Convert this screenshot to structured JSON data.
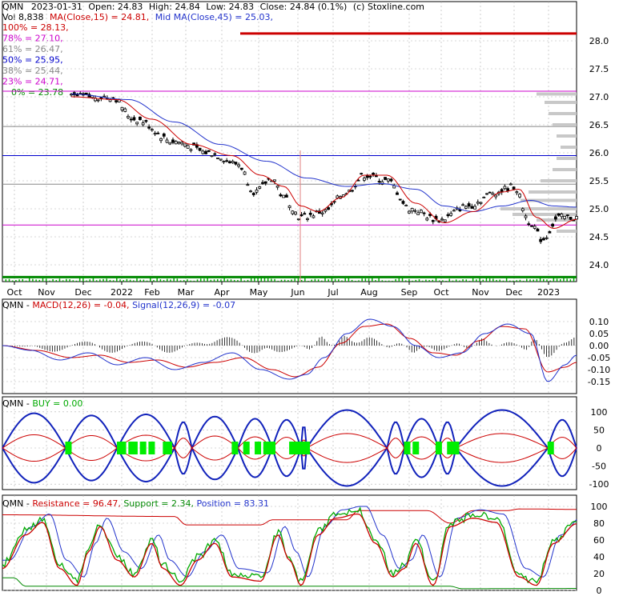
{
  "header": {
    "line1": {
      "ticker": "QMN",
      "date": "2023-01-31",
      "open": "Open: 24.83",
      "high": "High: 24.84",
      "low": "Low: 24.83",
      "close": "Close: 24.84 (0.1%)",
      "source": "(c) Stoxline.com"
    },
    "line2": {
      "vol": "Vol 8,838",
      "ma15": "MA(Close,15) = 24.81,",
      "ma45": "Mid MA(Close,45) = 25.03,"
    },
    "fib": [
      {
        "label": "100% = 28.13,",
        "color": "#cc0000"
      },
      {
        "label": "78% = 27.10,",
        "color": "#cc00cc"
      },
      {
        "label": "61% = 26.47,",
        "color": "#888888"
      },
      {
        "label": "50% = 25.95,",
        "color": "#0000cc"
      },
      {
        "label": "38% = 25.44,",
        "color": "#888888"
      },
      {
        "label": "23% = 24.71,",
        "color": "#cc00cc"
      },
      {
        "label": "0% = 23.78",
        "color": "#008800"
      }
    ]
  },
  "chart_data": [
    {
      "type": "candlestick",
      "panel": "price",
      "ylim": [
        23.7,
        28.3
      ],
      "yticks": [
        "28.0",
        "27.5",
        "27.0",
        "26.5",
        "26.0",
        "25.5",
        "25.0",
        "24.5",
        "24.0"
      ],
      "ytick_values": [
        28.0,
        27.5,
        27.0,
        26.5,
        26.0,
        25.5,
        25.0,
        24.5,
        24.0
      ],
      "xticks": [
        "Oct",
        "Nov",
        "Dec",
        "2022",
        "Feb",
        "Mar",
        "Apr",
        "May",
        "Jun",
        "Jul",
        "Aug",
        "Sep",
        "Oct",
        "Nov",
        "Dec",
        "2023"
      ],
      "fib_levels": [
        {
          "value": 28.13,
          "color": "#cc0000"
        },
        {
          "value": 27.1,
          "color": "#cc00cc"
        },
        {
          "value": 26.47,
          "color": "#888888"
        },
        {
          "value": 25.95,
          "color": "#0000cc"
        },
        {
          "value": 25.44,
          "color": "#888888"
        },
        {
          "value": 24.71,
          "color": "#cc00cc"
        },
        {
          "value": 23.78,
          "color": "#008800"
        }
      ],
      "close_keypoints": [
        [
          0.12,
          27.0
        ],
        [
          0.19,
          27.0
        ],
        [
          0.23,
          26.6
        ],
        [
          0.3,
          26.2
        ],
        [
          0.36,
          26.0
        ],
        [
          0.41,
          25.8
        ],
        [
          0.44,
          25.3
        ],
        [
          0.47,
          25.55
        ],
        [
          0.49,
          25.2
        ],
        [
          0.52,
          24.85
        ],
        [
          0.56,
          24.95
        ],
        [
          0.6,
          25.3
        ],
        [
          0.63,
          25.6
        ],
        [
          0.67,
          25.5
        ],
        [
          0.71,
          25.0
        ],
        [
          0.76,
          24.8
        ],
        [
          0.81,
          25.05
        ],
        [
          0.86,
          25.3
        ],
        [
          0.89,
          25.4
        ],
        [
          0.92,
          24.75
        ],
        [
          0.94,
          24.45
        ],
        [
          0.97,
          24.85
        ],
        [
          1.0,
          24.84
        ]
      ],
      "ma15_keypoints": [
        [
          0.12,
          27.0
        ],
        [
          0.2,
          26.95
        ],
        [
          0.26,
          26.6
        ],
        [
          0.33,
          26.15
        ],
        [
          0.4,
          25.95
        ],
        [
          0.45,
          25.6
        ],
        [
          0.49,
          25.4
        ],
        [
          0.52,
          25.05
        ],
        [
          0.55,
          24.95
        ],
        [
          0.59,
          25.2
        ],
        [
          0.63,
          25.6
        ],
        [
          0.67,
          25.6
        ],
        [
          0.72,
          25.1
        ],
        [
          0.77,
          24.75
        ],
        [
          0.82,
          24.95
        ],
        [
          0.87,
          25.3
        ],
        [
          0.9,
          25.35
        ],
        [
          0.93,
          24.85
        ],
        [
          0.96,
          24.65
        ],
        [
          1.0,
          24.81
        ]
      ],
      "ma45_keypoints": [
        [
          0.12,
          27.05
        ],
        [
          0.22,
          26.95
        ],
        [
          0.3,
          26.55
        ],
        [
          0.38,
          26.15
        ],
        [
          0.46,
          25.85
        ],
        [
          0.53,
          25.55
        ],
        [
          0.6,
          25.4
        ],
        [
          0.66,
          25.45
        ],
        [
          0.72,
          25.35
        ],
        [
          0.77,
          25.05
        ],
        [
          0.82,
          24.95
        ],
        [
          0.87,
          25.05
        ],
        [
          0.92,
          25.15
        ],
        [
          0.96,
          25.05
        ],
        [
          1.0,
          25.03
        ]
      ]
    },
    {
      "type": "line",
      "panel": "macd",
      "title_ticker": "QMN",
      "macd_label": "MACD(12,26) = -0.04,",
      "signal_label": "Signal(12,26,9) = -0.07",
      "ylim": [
        -0.2,
        0.15
      ],
      "yticks": [
        "0.10",
        "0.05",
        "0.00",
        "-0.05",
        "-0.10",
        "-0.15"
      ],
      "ytick_values": [
        0.1,
        0.05,
        0.0,
        -0.05,
        -0.1,
        -0.15
      ],
      "macd_keypoints": [
        [
          0,
          0.0
        ],
        [
          0.05,
          -0.02
        ],
        [
          0.1,
          -0.06
        ],
        [
          0.15,
          -0.03
        ],
        [
          0.2,
          -0.08
        ],
        [
          0.25,
          -0.05
        ],
        [
          0.3,
          -0.1
        ],
        [
          0.35,
          -0.07
        ],
        [
          0.4,
          -0.03
        ],
        [
          0.45,
          -0.1
        ],
        [
          0.5,
          -0.14
        ],
        [
          0.53,
          -0.12
        ],
        [
          0.56,
          -0.05
        ],
        [
          0.6,
          0.05
        ],
        [
          0.64,
          0.11
        ],
        [
          0.68,
          0.08
        ],
        [
          0.72,
          0.0
        ],
        [
          0.76,
          -0.05
        ],
        [
          0.8,
          -0.03
        ],
        [
          0.84,
          0.05
        ],
        [
          0.88,
          0.09
        ],
        [
          0.92,
          0.05
        ],
        [
          0.95,
          -0.15
        ],
        [
          0.98,
          -0.08
        ],
        [
          1.0,
          -0.04
        ]
      ],
      "signal_keypoints": [
        [
          0,
          0.0
        ],
        [
          0.06,
          -0.02
        ],
        [
          0.12,
          -0.05
        ],
        [
          0.17,
          -0.04
        ],
        [
          0.22,
          -0.07
        ],
        [
          0.27,
          -0.06
        ],
        [
          0.32,
          -0.09
        ],
        [
          0.37,
          -0.07
        ],
        [
          0.42,
          -0.05
        ],
        [
          0.47,
          -0.1
        ],
        [
          0.51,
          -0.13
        ],
        [
          0.55,
          -0.09
        ],
        [
          0.59,
          0.01
        ],
        [
          0.63,
          0.08
        ],
        [
          0.67,
          0.09
        ],
        [
          0.71,
          0.03
        ],
        [
          0.75,
          -0.03
        ],
        [
          0.79,
          -0.04
        ],
        [
          0.83,
          0.02
        ],
        [
          0.87,
          0.08
        ],
        [
          0.91,
          0.07
        ],
        [
          0.95,
          -0.11
        ],
        [
          0.98,
          -0.09
        ],
        [
          1.0,
          -0.07
        ]
      ]
    },
    {
      "type": "line",
      "panel": "buy",
      "title_ticker": "QMN",
      "buy_label": "BUY = 0.00",
      "ylim": [
        -115,
        115
      ],
      "yticks": [
        "100",
        "50",
        "0",
        "-50",
        "-100"
      ],
      "ytick_values": [
        100,
        50,
        0,
        -50,
        -100
      ],
      "buy_markers": [
        0.115,
        0.205,
        0.21,
        0.225,
        0.23,
        0.245,
        0.26,
        0.285,
        0.29,
        0.405,
        0.425,
        0.445,
        0.46,
        0.47,
        0.505,
        0.51,
        0.52,
        0.53,
        0.705,
        0.72,
        0.76,
        0.78,
        0.79,
        0.955
      ]
    },
    {
      "type": "line",
      "panel": "position",
      "title_ticker": "QMN",
      "resistance_label": "Resistance = 96.47,",
      "support_label": "Support = 2.34,",
      "position_label": "Position = 83.31",
      "ylim": [
        0,
        100
      ],
      "yticks": [
        "100",
        "80",
        "60",
        "40",
        "20",
        "0"
      ],
      "ytick_values": [
        100,
        80,
        60,
        40,
        20,
        0
      ],
      "resistance_keypoints": [
        [
          0,
          90
        ],
        [
          0.3,
          88
        ],
        [
          0.32,
          78
        ],
        [
          0.45,
          78
        ],
        [
          0.47,
          84
        ],
        [
          0.6,
          84
        ],
        [
          0.62,
          95
        ],
        [
          0.7,
          95
        ],
        [
          0.74,
          95
        ],
        [
          0.78,
          80
        ],
        [
          0.82,
          95
        ],
        [
          0.88,
          95
        ],
        [
          0.9,
          97
        ],
        [
          1.0,
          96.47
        ]
      ],
      "support_keypoints": [
        [
          0,
          15
        ],
        [
          0.02,
          15
        ],
        [
          0.04,
          5
        ],
        [
          0.78,
          5
        ],
        [
          0.8,
          2
        ],
        [
          1.0,
          2.34
        ]
      ],
      "position_keypoints": [
        [
          0,
          30
        ],
        [
          0.04,
          70
        ],
        [
          0.07,
          85
        ],
        [
          0.1,
          30
        ],
        [
          0.13,
          10
        ],
        [
          0.15,
          50
        ],
        [
          0.17,
          80
        ],
        [
          0.2,
          40
        ],
        [
          0.23,
          20
        ],
        [
          0.26,
          60
        ],
        [
          0.28,
          30
        ],
        [
          0.31,
          10
        ],
        [
          0.34,
          40
        ],
        [
          0.37,
          60
        ],
        [
          0.4,
          20
        ],
        [
          0.45,
          15
        ],
        [
          0.48,
          70
        ],
        [
          0.5,
          40
        ],
        [
          0.52,
          10
        ],
        [
          0.55,
          70
        ],
        [
          0.58,
          90
        ],
        [
          0.62,
          95
        ],
        [
          0.65,
          60
        ],
        [
          0.68,
          20
        ],
        [
          0.7,
          30
        ],
        [
          0.72,
          60
        ],
        [
          0.75,
          10
        ],
        [
          0.78,
          80
        ],
        [
          0.82,
          90
        ],
        [
          0.86,
          85
        ],
        [
          0.9,
          20
        ],
        [
          0.93,
          10
        ],
        [
          0.96,
          60
        ],
        [
          1.0,
          83.31
        ]
      ]
    }
  ],
  "colors": {
    "ma15": "#cc0000",
    "ma45": "#2233cc",
    "macd": "#2233cc",
    "signal": "#cc0000",
    "buy": "#00ee00",
    "band_outer": "#1122bb",
    "band_inner": "#cc0000",
    "resistance": "#cc0000",
    "support": "#008800",
    "position_red": "#cc0000",
    "position_green": "#00aa00",
    "position_blue": "#2233cc",
    "volume": "#888888",
    "grid": "#b0b0b0"
  }
}
